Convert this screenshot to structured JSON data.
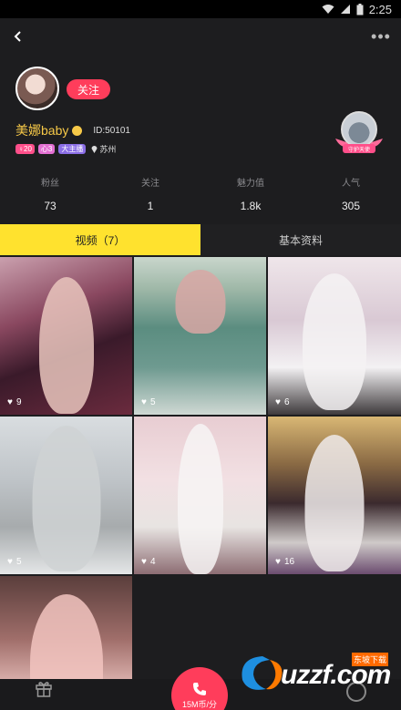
{
  "status_bar": {
    "time": "2:25"
  },
  "nav": {
    "back_icon": "chevron-left-icon",
    "more_icon": "more-dots-icon"
  },
  "profile": {
    "follow_label": "关注",
    "username": "美娜baby",
    "id_text": "ID:50101",
    "badges": [
      "♀20",
      "心3",
      "大主播"
    ],
    "location": "苏州",
    "guard_label": "守护天使"
  },
  "stats": [
    {
      "label": "粉丝",
      "value": "73"
    },
    {
      "label": "关注",
      "value": "1"
    },
    {
      "label": "魅力值",
      "value": "1.8k"
    },
    {
      "label": "人气",
      "value": "305"
    }
  ],
  "tabs": [
    {
      "label": "视频（7）",
      "active": true
    },
    {
      "label": "基本资料",
      "active": false
    }
  ],
  "videos": [
    {
      "likes": "9"
    },
    {
      "likes": "5"
    },
    {
      "likes": "6"
    },
    {
      "likes": "5"
    },
    {
      "likes": "4"
    },
    {
      "likes": "16"
    },
    {
      "likes": ""
    }
  ],
  "bottom": {
    "call_price": "15M币/分",
    "watermark": "uzzf.com",
    "watermark_small": "东坡下载"
  },
  "colors": {
    "accent": "#ff3d5b",
    "tab_active": "#ffe22e",
    "username": "#f7c948"
  }
}
